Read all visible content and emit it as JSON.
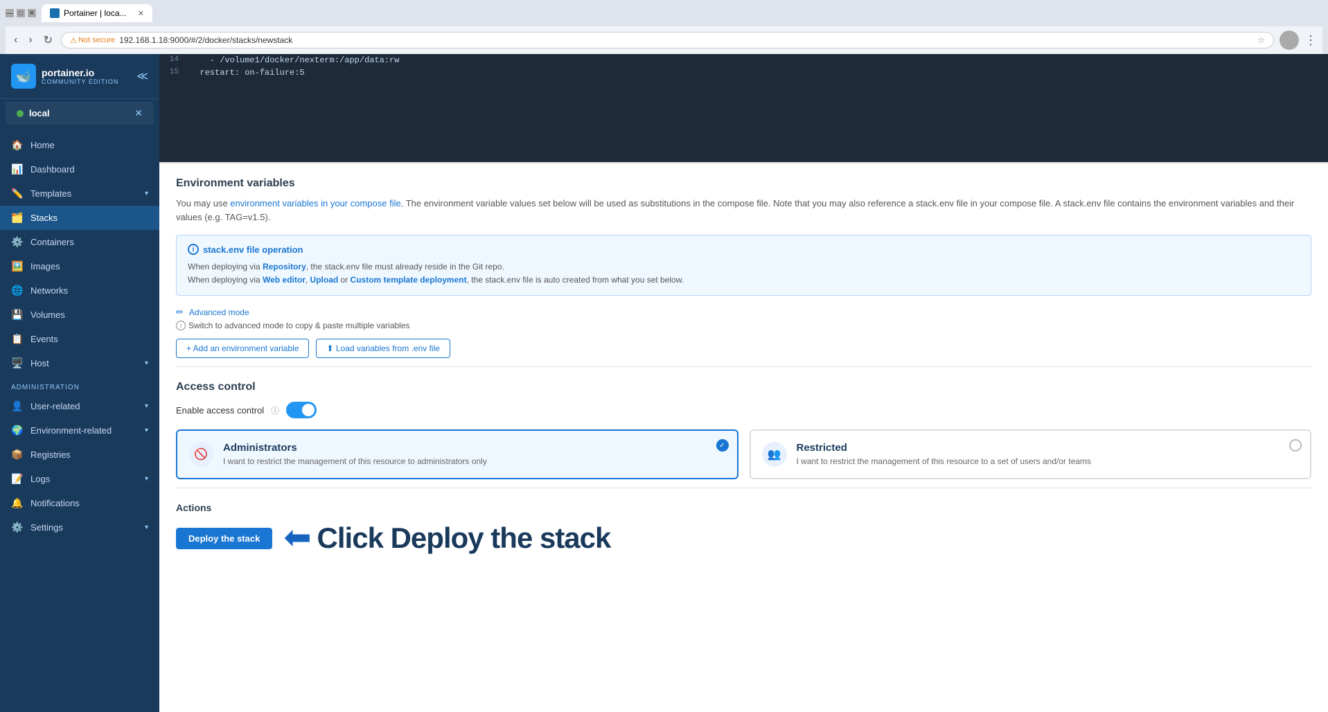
{
  "browser": {
    "tab_title": "Portainer | loca...",
    "url": "192.168.1.18:9000/#/2/docker/stacks/newstack",
    "not_secure_label": "Not secure"
  },
  "sidebar": {
    "logo_main": "portainer.io",
    "logo_sub": "COMMUNITY EDITION",
    "env_name": "local",
    "nav_items": [
      {
        "id": "home",
        "label": "Home",
        "icon": "🏠",
        "has_arrow": false
      },
      {
        "id": "dashboard",
        "label": "Dashboard",
        "icon": "📊",
        "has_arrow": false
      },
      {
        "id": "templates",
        "label": "Templates",
        "icon": "✏️",
        "has_arrow": true
      },
      {
        "id": "stacks",
        "label": "Stacks",
        "icon": "🗂️",
        "has_arrow": false,
        "active": true
      },
      {
        "id": "containers",
        "label": "Containers",
        "icon": "⚙️",
        "has_arrow": false
      },
      {
        "id": "images",
        "label": "Images",
        "icon": "🖼️",
        "has_arrow": false
      },
      {
        "id": "networks",
        "label": "Networks",
        "icon": "🌐",
        "has_arrow": false
      },
      {
        "id": "volumes",
        "label": "Volumes",
        "icon": "💾",
        "has_arrow": false
      },
      {
        "id": "events",
        "label": "Events",
        "icon": "📋",
        "has_arrow": false
      },
      {
        "id": "host",
        "label": "Host",
        "icon": "🖥️",
        "has_arrow": true
      }
    ],
    "admin_section": "Administration",
    "admin_items": [
      {
        "id": "user-related",
        "label": "User-related",
        "icon": "👤",
        "has_arrow": true
      },
      {
        "id": "environment-related",
        "label": "Environment-related",
        "icon": "🌍",
        "has_arrow": true
      },
      {
        "id": "registries",
        "label": "Registries",
        "icon": "📦",
        "has_arrow": false
      },
      {
        "id": "logs",
        "label": "Logs",
        "icon": "📝",
        "has_arrow": true
      },
      {
        "id": "notifications",
        "label": "Notifications",
        "icon": "🔔",
        "has_arrow": false
      },
      {
        "id": "settings",
        "label": "Settings",
        "icon": "⚙️",
        "has_arrow": true
      }
    ]
  },
  "code_editor": {
    "lines": [
      {
        "num": "14",
        "code": "    - /volume1/docker/nexterm:/app/data:rw"
      },
      {
        "num": "15",
        "code": "  restart: on-failure:5"
      }
    ]
  },
  "env_variables": {
    "section_title": "Environment variables",
    "description": "You may use environment variables in your compose file. The environment variable values set below will be used as substitutions in the compose file. Note that you may also reference a stack.env file in your compose file. A stack.env file contains the environment variables and their values (e.g. TAG=v1.5).",
    "env_link_text": "environment variables in your compose file",
    "info_box": {
      "title": "stack.env file operation",
      "line1_pre": "When deploying via ",
      "line1_bold": "Repository",
      "line1_post": ", the stack.env file must already reside in the Git repo.",
      "line2_pre": "When deploying via ",
      "line2_bold1": "Web editor",
      "line2_mid": ", ",
      "line2_bold2": "Upload",
      "line2_mid2": " or ",
      "line2_bold3": "Custom template deployment",
      "line2_post": ", the stack.env file is auto created from what you set below."
    },
    "advanced_mode_label": "Advanced mode",
    "advanced_mode_desc": "Switch to advanced mode to copy & paste multiple variables",
    "add_btn": "+ Add an environment variable",
    "load_btn": "⬆ Load variables from .env file"
  },
  "access_control": {
    "section_title": "Access control",
    "enable_label": "Enable access control",
    "cards": [
      {
        "id": "administrators",
        "title": "Administrators",
        "description": "I want to restrict the management of this resource to administrators only",
        "selected": true
      },
      {
        "id": "restricted",
        "title": "Restricted",
        "description": "I want to restrict the management of this resource to a set of users and/or teams",
        "selected": false
      }
    ]
  },
  "actions": {
    "section_title": "Actions",
    "deploy_btn": "Deploy the stack",
    "annotation_text": "Click Deploy the stack"
  }
}
